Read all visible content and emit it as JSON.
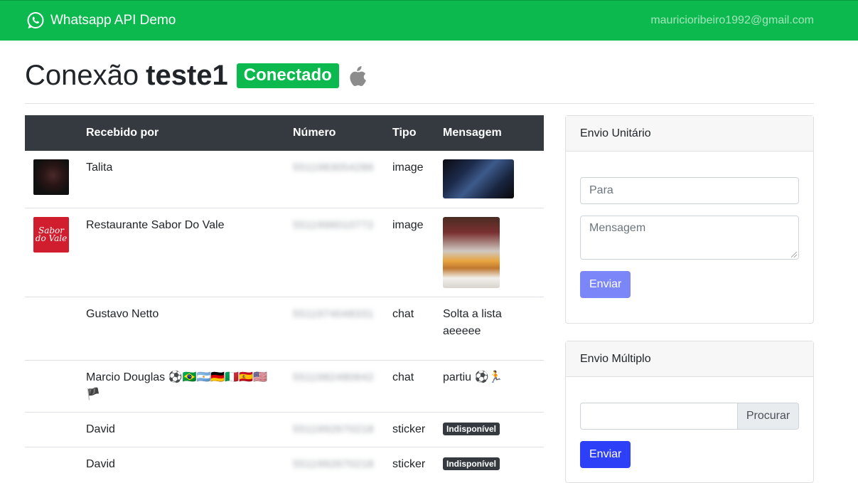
{
  "navbar": {
    "brand": "Whatsapp API Demo",
    "brand_icon": "whatsapp-icon",
    "user_email": "mauricioribeiro1992@gmail.com",
    "color": "#0cb94e"
  },
  "header": {
    "title_prefix": "Conexão",
    "connection_name": "teste1",
    "status": "Conectado",
    "platform_icon": "apple-icon"
  },
  "table": {
    "columns": [
      "",
      "Recebido por",
      "Número",
      "Tipo",
      "Mensagem"
    ],
    "rows": [
      {
        "avatar": "photo",
        "name": "Talita",
        "number": "5511983054286",
        "type": "image",
        "message_kind": "image"
      },
      {
        "avatar": "Sabor do Vale",
        "name": "Restaurante Sabor Do Vale",
        "number": "5511996010772",
        "type": "image",
        "message_kind": "image"
      },
      {
        "avatar": "",
        "name": "Gustavo Netto",
        "number": "5511974048331",
        "type": "chat",
        "message": "Solta a lista aeeeee"
      },
      {
        "avatar": "",
        "name": "Marcio Douglas ⚽🇧🇷🇦🇷🇩🇪🇮🇹🇪🇸🇺🇸🏴",
        "number": "5511982480642",
        "type": "chat",
        "message": "partiu ⚽🏃"
      },
      {
        "avatar": "",
        "name": "David",
        "number": "5511992670218",
        "type": "sticker",
        "message": "Indisponível"
      },
      {
        "avatar": "",
        "name": "David",
        "number": "5511992670218",
        "type": "sticker",
        "message": "Indisponível"
      }
    ]
  },
  "single_send": {
    "title": "Envio Unitário",
    "to_placeholder": "Para",
    "message_placeholder": "Mensagem",
    "submit_label": "Enviar"
  },
  "multi_send": {
    "title": "Envio Múltiplo",
    "browse_label": "Procurar",
    "submit_label": "Enviar"
  }
}
